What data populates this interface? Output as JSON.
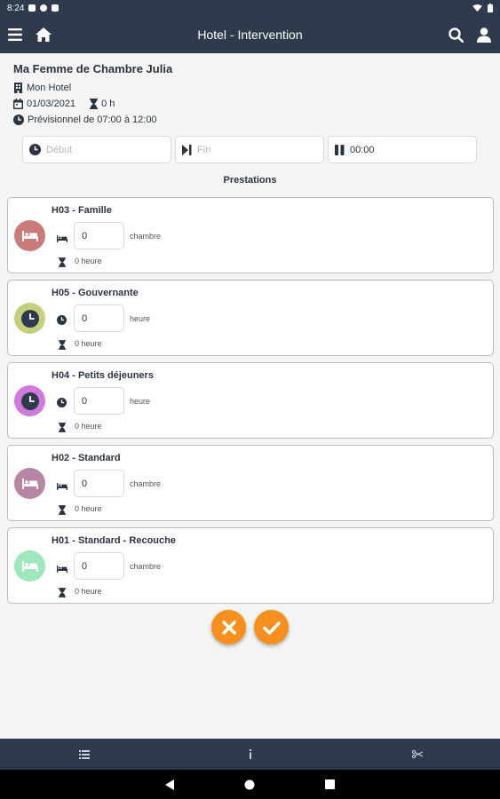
{
  "status_bar": {
    "time": "8:24"
  },
  "app_bar": {
    "title": "Hotel - Intervention"
  },
  "header": {
    "staff_name": "Ma Femme de Chambre Julia",
    "hotel": "Mon Hotel",
    "date": "01/03/2021",
    "duration": "0 h",
    "forecast": "Prévisionnel de 07:00 à 12:00"
  },
  "time_fields": {
    "start_placeholder": "Début",
    "end_placeholder": "Fin",
    "pause_value": "00:00"
  },
  "section_title": "Prestations",
  "prestations": [
    {
      "title": "H03 - Famille",
      "quantity": "0",
      "unit": "chambre",
      "duration": "0 heure",
      "icon": "bed-icon",
      "color": "#c97b7b"
    },
    {
      "title": "H05 - Gouvernante",
      "quantity": "0",
      "unit": "heure",
      "duration": "0 heure",
      "icon": "clock-icon",
      "color": "#c6cf7e"
    },
    {
      "title": "H04 - Petits déjeuners",
      "quantity": "0",
      "unit": "heure",
      "duration": "0 heure",
      "icon": "clock-icon",
      "color": "#d07bdc"
    },
    {
      "title": "H02 - Standard",
      "quantity": "0",
      "unit": "chambre",
      "duration": "0 heure",
      "icon": "bed-icon",
      "color": "#b786a6"
    },
    {
      "title": "H01 - Standard - Recouche",
      "quantity": "0",
      "unit": "chambre",
      "duration": "0 heure",
      "icon": "bed-icon",
      "color": "#9ee6bb"
    }
  ],
  "colors": {
    "primary": "#2f3b4c",
    "accent": "#f5901f",
    "background": "#f4f4f4"
  }
}
